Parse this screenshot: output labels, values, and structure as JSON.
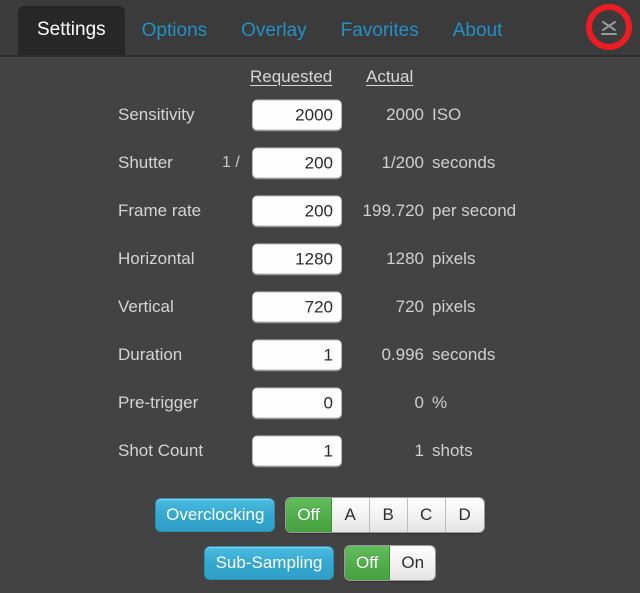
{
  "window": {
    "active_tab": "Settings",
    "background_color": "#434343",
    "accent_blue": "#2391c6",
    "accent_green": "#52ad4c",
    "annotation_color": "#ec1c24"
  },
  "tabs": [
    {
      "label": "Settings",
      "active": true
    },
    {
      "label": "Options",
      "active": false
    },
    {
      "label": "Overlay",
      "active": false
    },
    {
      "label": "Favorites",
      "active": false
    },
    {
      "label": "About",
      "active": false
    }
  ],
  "close_button": {
    "icon": "close-x-icon",
    "label": "X"
  },
  "columns": {
    "requested": "Requested",
    "actual": "Actual"
  },
  "rows": [
    {
      "label": "Sensitivity",
      "prefix": "",
      "value": "2000",
      "placeholder": "",
      "actual": "2000",
      "unit": "ISO"
    },
    {
      "label": "Shutter",
      "prefix": "1 /",
      "value": "200",
      "placeholder": "",
      "actual": "1/200",
      "unit": "seconds"
    },
    {
      "label": "Frame rate",
      "prefix": "",
      "value": "200",
      "placeholder": "",
      "actual": "199.720",
      "unit": "per second"
    },
    {
      "label": "Horizontal",
      "prefix": "",
      "value": "1280",
      "placeholder": "",
      "actual": "1280",
      "unit": "pixels"
    },
    {
      "label": "Vertical",
      "prefix": "",
      "value": "720",
      "placeholder": "",
      "actual": "720",
      "unit": "pixels"
    },
    {
      "label": "Duration",
      "prefix": "",
      "value": "1",
      "placeholder": "",
      "actual": "0.996",
      "unit": "seconds"
    },
    {
      "label": "Pre-trigger",
      "prefix": "",
      "value": "0",
      "placeholder": "",
      "actual": "0",
      "unit": "%"
    },
    {
      "label": "Shot Count",
      "prefix": "",
      "value": "1",
      "placeholder": "",
      "actual": "1",
      "unit": "shots"
    }
  ],
  "overclocking": {
    "label": "Overclocking",
    "options": [
      {
        "label": "Off",
        "selected": true
      },
      {
        "label": "A",
        "selected": false
      },
      {
        "label": "B",
        "selected": false
      },
      {
        "label": "C",
        "selected": false
      },
      {
        "label": "D",
        "selected": false
      }
    ]
  },
  "subsampling": {
    "label": "Sub-Sampling",
    "options": [
      {
        "label": "Off",
        "selected": true
      },
      {
        "label": "On",
        "selected": false
      }
    ]
  }
}
